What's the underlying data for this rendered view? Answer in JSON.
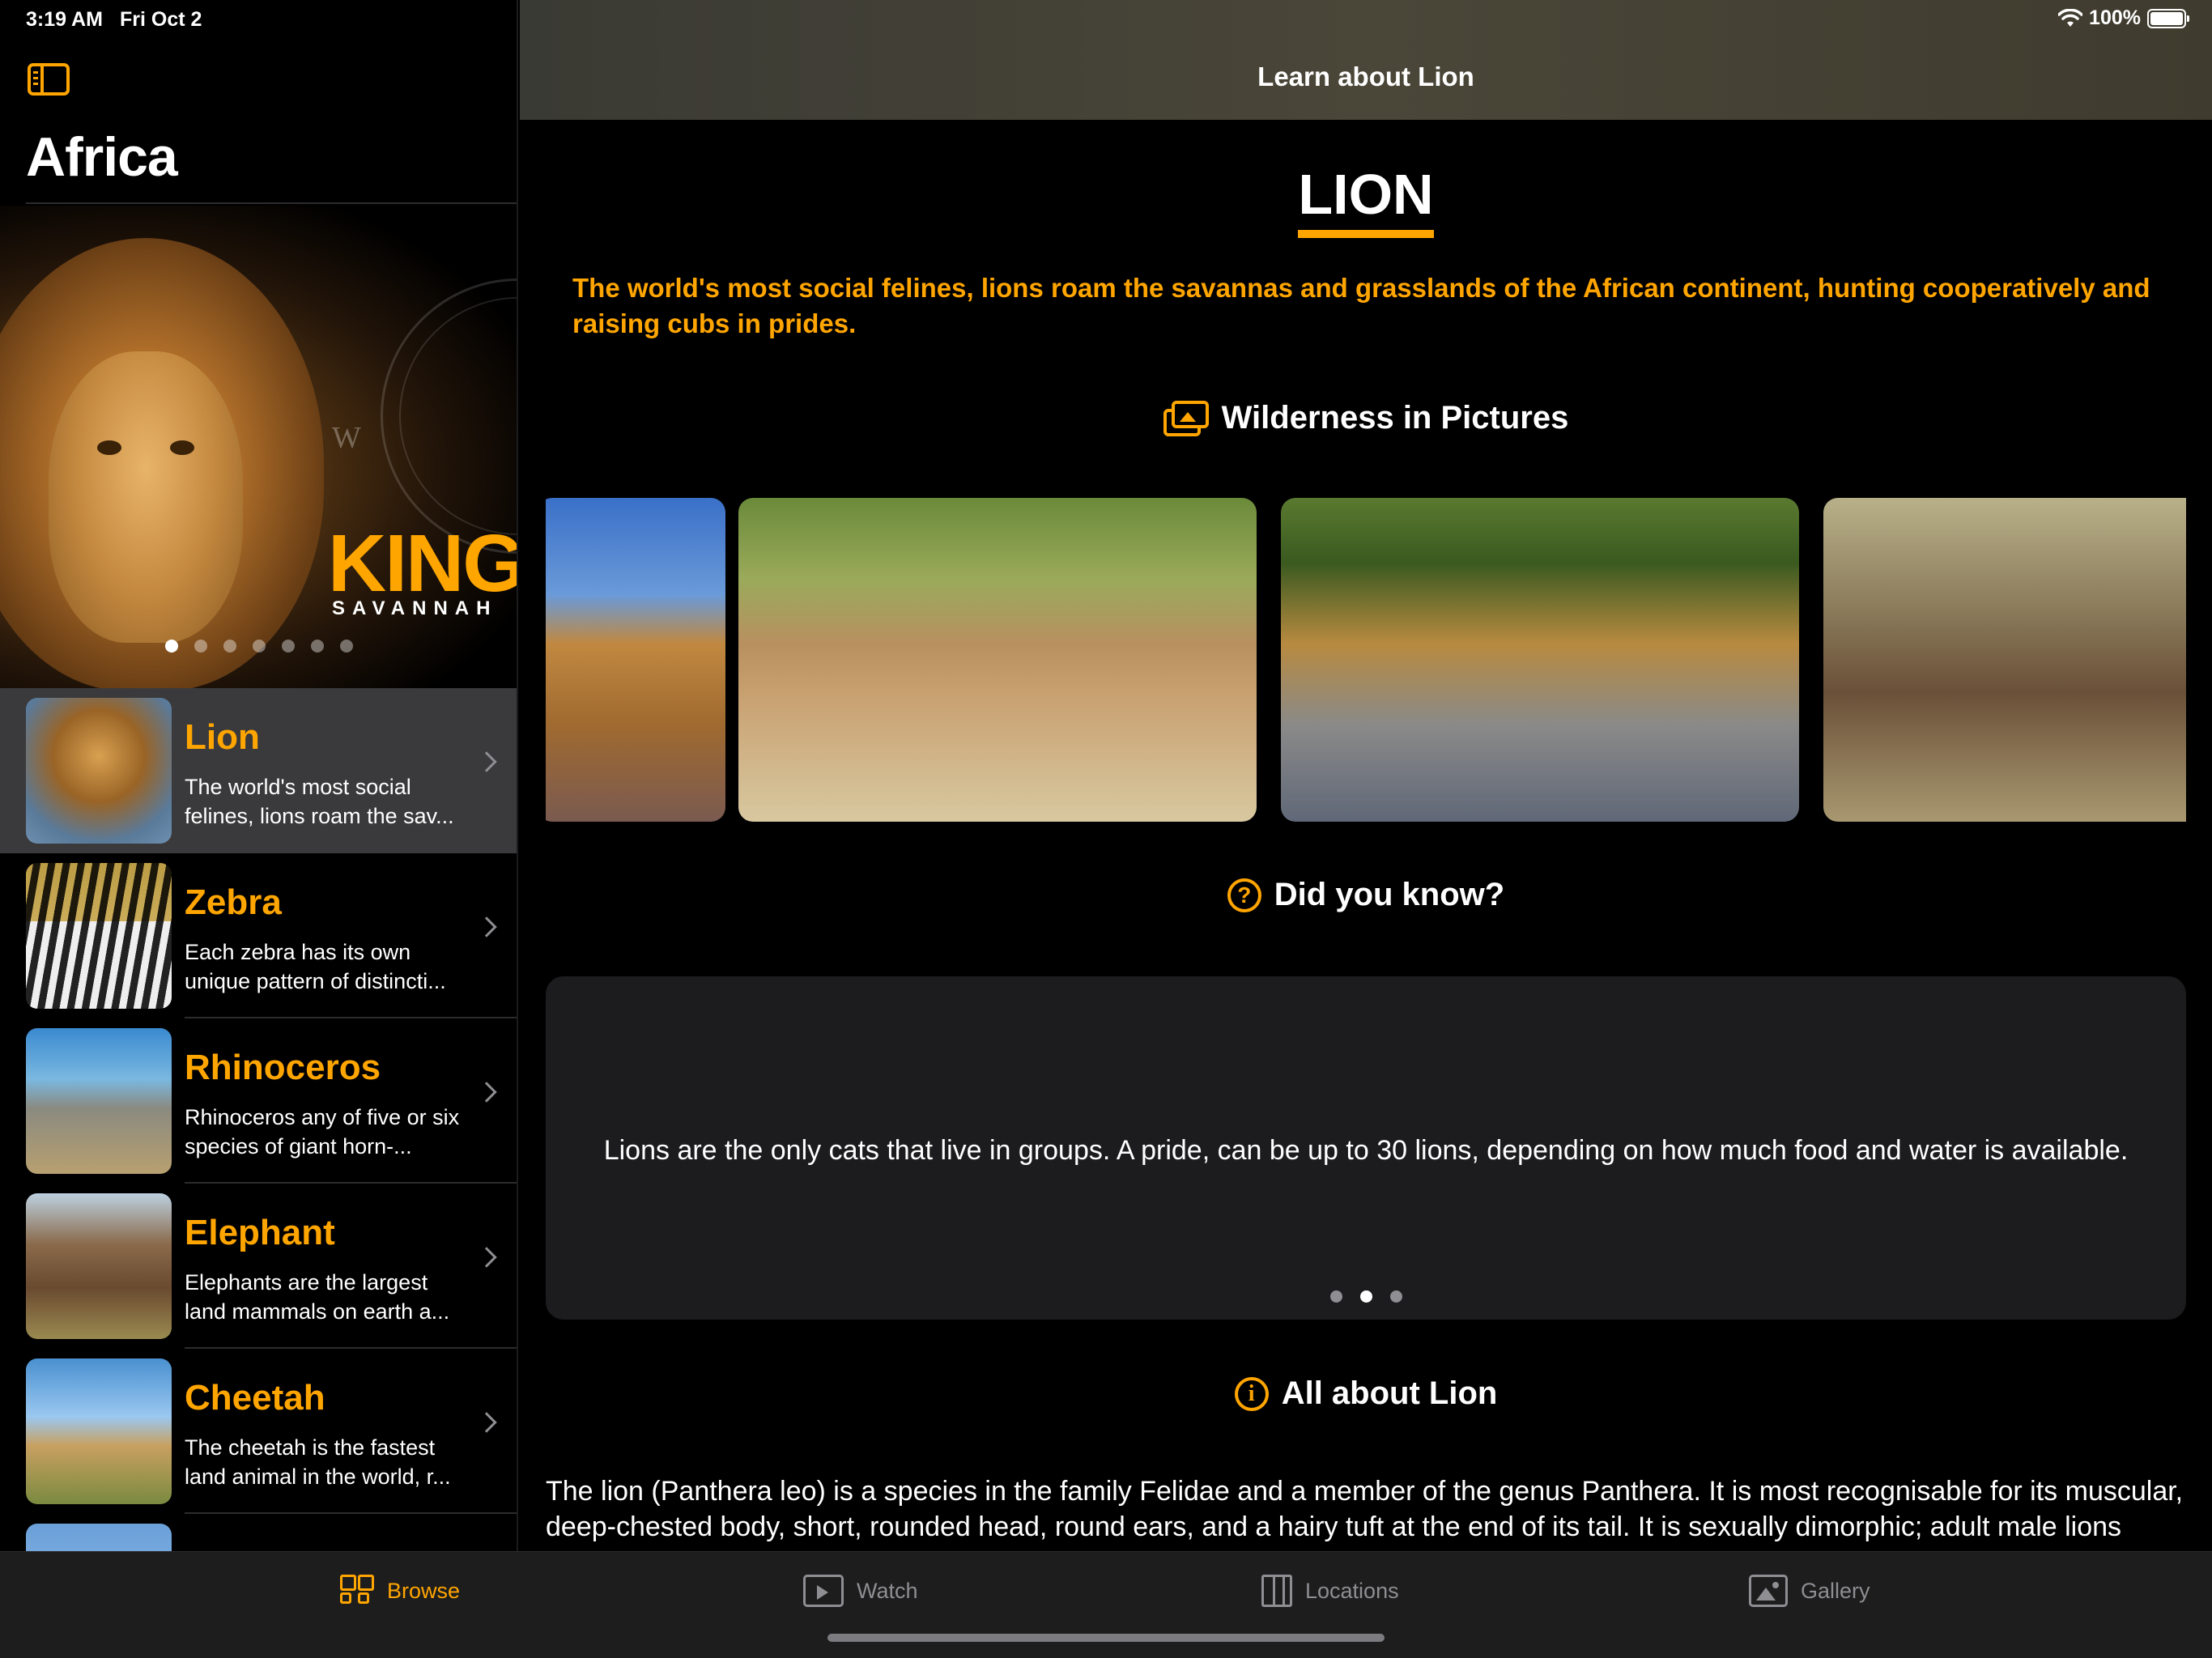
{
  "status": {
    "time": "3:19 AM",
    "date": "Fri Oct 2",
    "battery": "100%"
  },
  "sidebar": {
    "title": "Africa",
    "hero": {
      "headline": "KING",
      "subline": "SAVANNAH",
      "compass_letter": "W",
      "page_count": 7,
      "active_page": 0
    },
    "items": [
      {
        "name": "Lion",
        "desc": "The world's most social felines, lions roam the sav...",
        "selected": true
      },
      {
        "name": "Zebra",
        "desc": "Each zebra has its own unique pattern of distincti...",
        "selected": false
      },
      {
        "name": "Rhinoceros",
        "desc": "Rhinoceros any of five or six species of giant horn-...",
        "selected": false
      },
      {
        "name": "Elephant",
        "desc": "Elephants are the largest land mammals on earth a...",
        "selected": false
      },
      {
        "name": "Cheetah",
        "desc": "The cheetah is the fastest land animal in the world, r...",
        "selected": false
      }
    ]
  },
  "detail": {
    "nav_title": "Learn about Lion",
    "title": "LION",
    "intro": "The world's most social felines, lions roam the savannas and grasslands of the African continent, hunting cooperatively and raising cubs in prides.",
    "gallery_heading": "Wilderness in Pictures",
    "did_you_know_heading": "Did you know?",
    "did_you_know_icon": "?",
    "fact": "Lions are the only cats that live in groups. A pride, can be up to 30 lions, depending on how much food and water is available.",
    "fact_pages": 3,
    "fact_active_page": 1,
    "about_heading": "All about Lion",
    "about_icon": "i",
    "about_text": "The lion (Panthera leo) is a species in the family Felidae and a member of the genus Panthera. It is most recognisable for its muscular, deep-chested body, short, rounded head, round ears, and a hairy tuft at the end of its tail. It is sexually dimorphic; adult male lions"
  },
  "tabbar": {
    "tabs": [
      {
        "label": "Browse",
        "icon": "grid-icon",
        "active": true
      },
      {
        "label": "Watch",
        "icon": "play-icon",
        "active": false
      },
      {
        "label": "Locations",
        "icon": "map-icon",
        "active": false
      },
      {
        "label": "Gallery",
        "icon": "photo-icon",
        "active": false
      }
    ]
  },
  "colors": {
    "accent": "#FFA500",
    "background": "#000000",
    "card": "#1C1C1E",
    "selected_row": "#3A3A3C"
  }
}
